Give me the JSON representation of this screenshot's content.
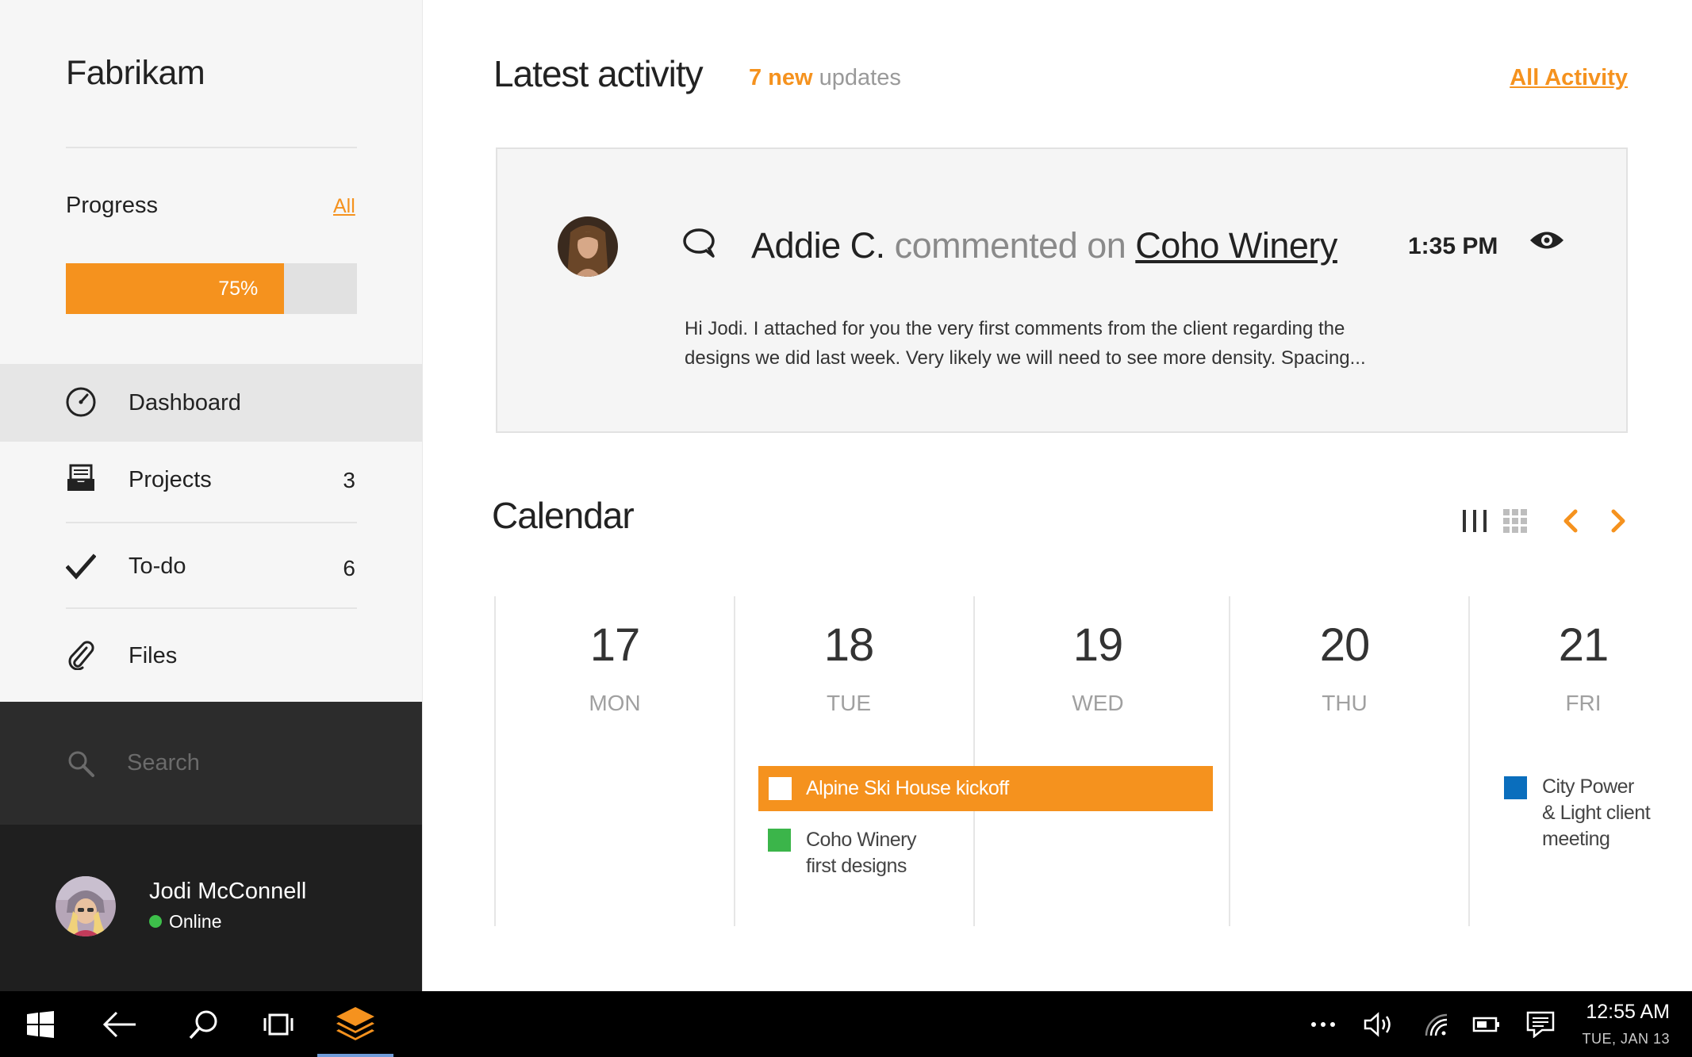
{
  "sidebar": {
    "app_title": "Fabrikam",
    "progress": {
      "label": "Progress",
      "all_link": "All",
      "percent_text": "75%",
      "value": 0.75
    },
    "nav": [
      {
        "label": "Dashboard",
        "icon": "speedometer-icon",
        "count": ""
      },
      {
        "label": "Projects",
        "icon": "inbox-tray-icon",
        "count": "3"
      },
      {
        "label": "To-do",
        "icon": "checkmark-icon",
        "count": "6"
      },
      {
        "label": "Files",
        "icon": "paperclip-icon",
        "count": ""
      }
    ],
    "search": {
      "placeholder": "Search"
    },
    "user": {
      "name": "Jodi McConnell",
      "status": "Online"
    }
  },
  "activity": {
    "title": "Latest activity",
    "updates_count": "7 new",
    "updates_suffix": " updates",
    "all_link": "All Activity",
    "card": {
      "author": "Addie C.",
      "action": " commented on ",
      "target": "Coho Winery",
      "time": "1:35 PM",
      "body": "Hi Jodi. I attached for you the very first comments from the client regarding the designs we did last week. Very likely we will need to see more density. Spacing..."
    }
  },
  "calendar": {
    "title": "Calendar",
    "days": [
      {
        "num": "17",
        "name": "MON"
      },
      {
        "num": "18",
        "name": "TUE"
      },
      {
        "num": "19",
        "name": "WED"
      },
      {
        "num": "20",
        "name": "THU"
      },
      {
        "num": "21",
        "name": "FRI"
      }
    ],
    "events": {
      "alpine": "Alpine Ski House kickoff",
      "coho_line1": "Coho Winery",
      "coho_line2": "first designs",
      "city_line1": "City Power",
      "city_line2": "& Light client",
      "city_line3": "meeting"
    }
  },
  "taskbar": {
    "time": "12:55 AM",
    "date": "TUE, JAN 13"
  },
  "colors": {
    "accent": "#f5921e",
    "green": "#3dbf4a",
    "blue": "#0a6ebd",
    "event_green": "#3bb54a"
  }
}
